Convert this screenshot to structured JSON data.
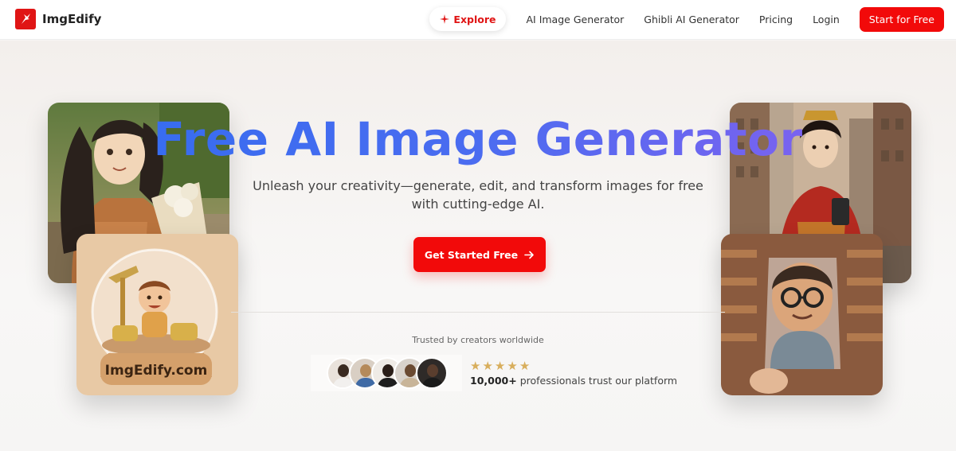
{
  "brand": {
    "name": "ImgEdify"
  },
  "nav": {
    "explore": "Explore",
    "links": [
      "AI Image Generator",
      "Ghibli AI Generator",
      "Pricing",
      "Login"
    ],
    "cta": "Start for Free"
  },
  "hero": {
    "title": "Free AI Image Generator",
    "subtitle": "Unleash your creativity—generate, edit, and transform images for free with cutting-edge AI.",
    "cta": "Get Started Free"
  },
  "trust": {
    "heading": "Trusted by creators worldwide",
    "stars": 5,
    "count": "10,000+",
    "text": "professionals trust our platform"
  },
  "images": {
    "globe_caption": "ImgEdify.com"
  },
  "colors": {
    "accent": "#f20a0a",
    "title_gradient_start": "#2f6df0",
    "title_gradient_end": "#8f5ef0",
    "star": "#d8ae5c"
  },
  "icons": {
    "explore": "sparkle-icon",
    "cta": "arrow-right-icon",
    "rating": "star-icon"
  }
}
